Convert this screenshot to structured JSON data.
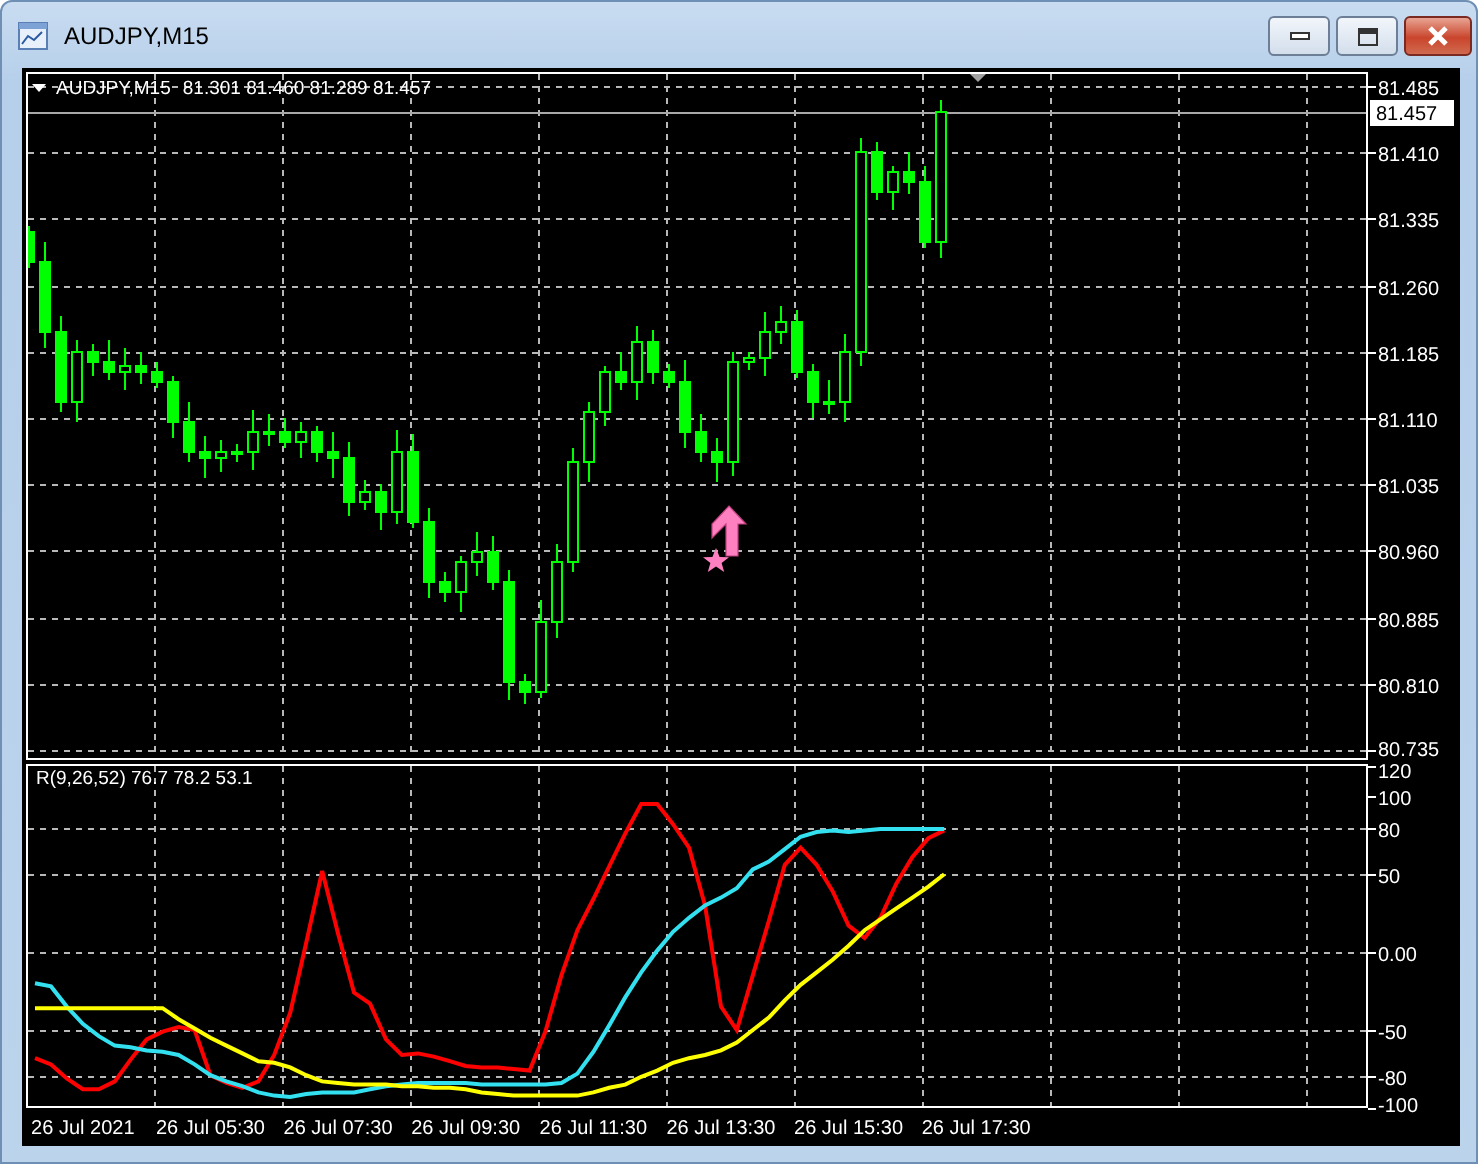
{
  "window": {
    "title": "AUDJPY,M15"
  },
  "main_chart": {
    "symbol": "AUDJPY,M15",
    "ohlc": "81.301 81.460 81.289 81.457",
    "current_price": "81.457",
    "price_ticks": [
      "81.485",
      "81.410",
      "81.335",
      "81.260",
      "81.185",
      "81.110",
      "81.035",
      "80.960",
      "80.885",
      "80.810",
      "80.735"
    ]
  },
  "indicator": {
    "label": "R(9,26,52) 76.7 78.2 53.1",
    "chart_data": {
      "type": "line",
      "ylim": [
        -100,
        120
      ],
      "yticks": [
        120,
        100,
        80,
        50,
        {
          "value": 0,
          "label": "0.00"
        },
        -50,
        -80,
        -100
      ],
      "categories": [
        null,
        null,
        null,
        "26 Jul 2021",
        null,
        null,
        null,
        null,
        null,
        null,
        null,
        "26 Jul 05:30",
        null,
        null,
        null,
        null,
        null,
        null,
        null,
        "26 Jul 07:30",
        null,
        null,
        null,
        null,
        null,
        null,
        null,
        "26 Jul 09:30",
        null,
        null,
        null,
        null,
        null,
        null,
        null,
        "26 Jul 11:30",
        null,
        null,
        null,
        null,
        null,
        null,
        null,
        "26 Jul 13:30",
        null,
        null,
        null,
        null,
        null,
        null,
        null,
        "26 Jul 15:30",
        null,
        null,
        null,
        null,
        null,
        null,
        null,
        "26 Jul 17:30",
        null,
        null,
        null,
        null,
        null,
        null,
        null,
        null,
        null,
        null,
        null,
        null,
        null,
        null,
        null,
        null,
        null,
        null,
        null,
        null,
        null,
        null,
        null,
        null
      ],
      "grid": true,
      "series": [
        {
          "color": "#ff0000",
          "values": [
            -68,
            -72,
            -81,
            -88,
            -88,
            -83,
            -69,
            -56,
            -51,
            -48,
            -50,
            -79,
            -84,
            -87,
            -83,
            -66,
            -39,
            6,
            52,
            12,
            -26,
            -33,
            -56,
            -66,
            -65,
            -67,
            -70,
            -73,
            -74,
            -74,
            -75,
            -76,
            -51,
            -15,
            14,
            34,
            55,
            76,
            95,
            95,
            82,
            67,
            30,
            -35,
            -50,
            -15,
            20,
            56,
            67,
            56,
            39,
            17,
            9,
            22,
            44,
            61,
            73,
            78,
            null,
            null,
            null,
            null,
            null,
            null,
            null,
            null,
            null,
            null,
            null,
            null,
            null,
            null,
            null,
            null,
            null,
            null,
            null,
            null,
            null,
            null,
            null,
            null,
            null,
            null
          ]
        },
        {
          "color": "#33e0f0",
          "values": [
            -20,
            -22,
            -35,
            -46,
            -54,
            -60,
            -61,
            -63,
            -64,
            -66,
            -72,
            -79,
            -83,
            -86,
            -90,
            -92,
            -93,
            -91,
            -90,
            -90,
            -90,
            -88,
            -86,
            -85,
            -84,
            -84,
            -84,
            -84,
            -85,
            -85,
            -85,
            -85,
            -85,
            -84,
            -78,
            -64,
            -47,
            -29,
            -13,
            1,
            13,
            22,
            30,
            35,
            41,
            53,
            58,
            66,
            74,
            77,
            78,
            77,
            78,
            79,
            79,
            79,
            79,
            79,
            null,
            null,
            null,
            null,
            null,
            null,
            null,
            null,
            null,
            null,
            null,
            null,
            null,
            null,
            null,
            null,
            null,
            null,
            null,
            null,
            null,
            null,
            null,
            null,
            null,
            null
          ]
        },
        {
          "color": "#ffff00",
          "values": [
            -36,
            -36,
            -36,
            -36,
            -36,
            -36,
            -36,
            -36,
            -36,
            -43,
            -49,
            -55,
            -60,
            -65,
            -70,
            -71,
            -74,
            -79,
            -83,
            -84,
            -85,
            -85,
            -85,
            -86,
            -86,
            -87,
            -87,
            -88,
            -90,
            -91,
            -92,
            -92,
            -92,
            -92,
            -92,
            -90,
            -87,
            -85,
            -80,
            -76,
            -71,
            -68,
            -66,
            -63,
            -58,
            -50,
            -42,
            -31,
            -21,
            -13,
            -5,
            4,
            14,
            21,
            28,
            35,
            42,
            50,
            null,
            null,
            null,
            null,
            null,
            null,
            null,
            null,
            null,
            null,
            null,
            null,
            null,
            null,
            null,
            null,
            null,
            null,
            null,
            null,
            null,
            null,
            null,
            null,
            null,
            null
          ]
        }
      ]
    }
  }
}
